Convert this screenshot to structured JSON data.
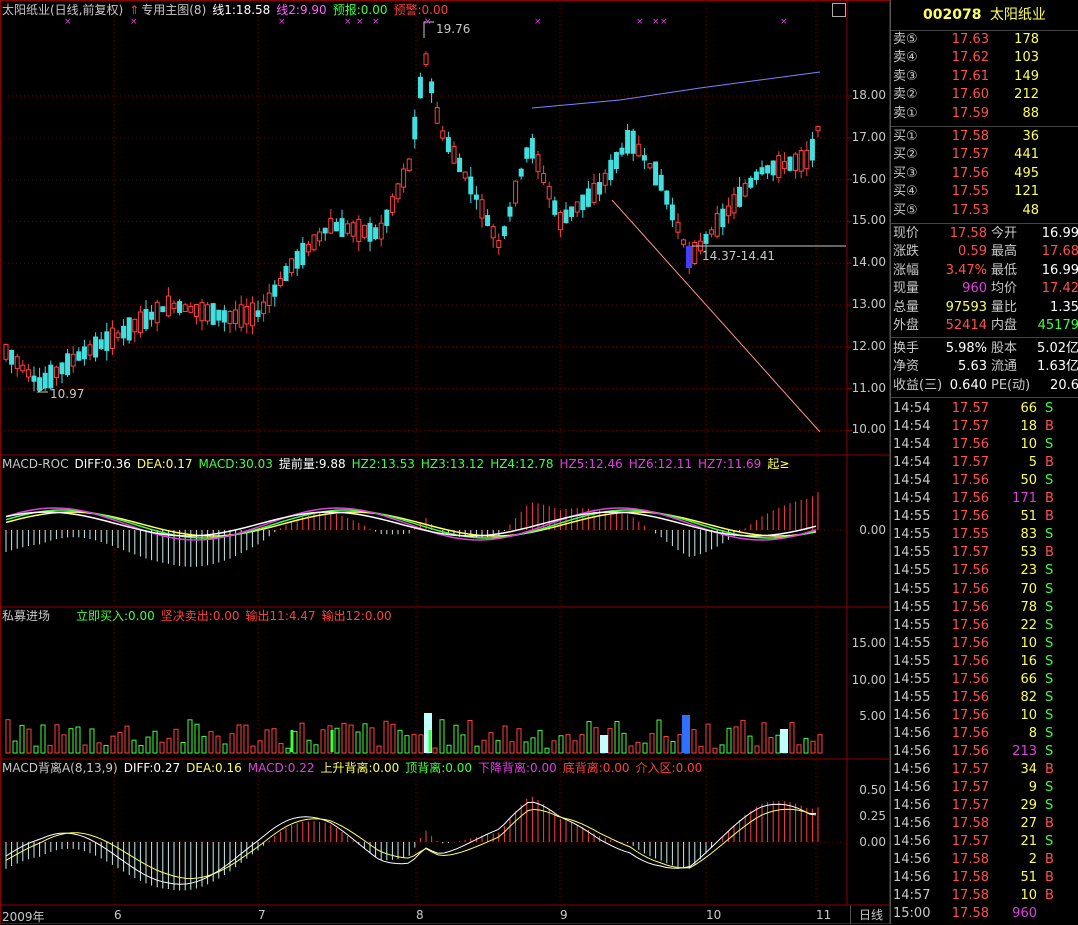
{
  "stock": {
    "code": "002078",
    "name": "太阳纸业"
  },
  "main_title": {
    "name": "太阳纸业(日线,前复权)",
    "indicator": "专用主图(8)",
    "line1": "线1:18.58",
    "line2": "线2:9.90",
    "forecast": "预报:0.00",
    "warning": "预警:0.00"
  },
  "main_labels": {
    "high": "19.76",
    "low": "10.97",
    "range": "14.37-14.41"
  },
  "price_axis": [
    "18.00",
    "17.00",
    "16.00",
    "15.00",
    "14.00",
    "13.00",
    "12.00",
    "11.00",
    "10.00"
  ],
  "macd_roc": {
    "name": "MACD-ROC",
    "diff": "DIFF:0.36",
    "dea": "DEA:0.17",
    "macd": "MACD:30.03",
    "tqz": "提前量:9.88",
    "hz2": "HZ2:13.53",
    "hz3": "HZ3:13.12",
    "hz4": "HZ4:12.78",
    "hz5": "HZ5:12.46",
    "hz6": "HZ6:12.11",
    "hz7": "HZ7:11.69",
    "extra": "起≥",
    "axis": "0.00"
  },
  "private": {
    "name": "私募进场",
    "buy": "立即买入:0.00",
    "sell": "坚决卖出:0.00",
    "out1": "输出11:4.47",
    "out2": "输出12:0.00",
    "axis": [
      "15.00",
      "10.00",
      "5.00"
    ]
  },
  "divergence": {
    "name": "MACD背离A(8,13,9)",
    "diff": "DIFF:0.27",
    "dea": "DEA:0.16",
    "macd": "MACD:0.22",
    "up": "上升背离:0.00",
    "top": "顶背离:0.00",
    "down": "下降背离:0.00",
    "bottom": "底背离:0.00",
    "zone": "介入区:0.00",
    "axis": [
      "0.50",
      "0.25",
      "0.00"
    ]
  },
  "dates": [
    "2009年",
    "6",
    "7",
    "8",
    "9",
    "10",
    "11"
  ],
  "bottom_tab": "日线",
  "sell_orders": [
    {
      "label": "卖⑤",
      "price": "17.63",
      "vol": "178"
    },
    {
      "label": "卖④",
      "price": "17.62",
      "vol": "103"
    },
    {
      "label": "卖③",
      "price": "17.61",
      "vol": "149"
    },
    {
      "label": "卖②",
      "price": "17.60",
      "vol": "212"
    },
    {
      "label": "卖①",
      "price": "17.59",
      "vol": "88"
    }
  ],
  "buy_orders": [
    {
      "label": "买①",
      "price": "17.58",
      "vol": "36"
    },
    {
      "label": "买②",
      "price": "17.57",
      "vol": "441"
    },
    {
      "label": "买③",
      "price": "17.56",
      "vol": "495"
    },
    {
      "label": "买④",
      "price": "17.55",
      "vol": "121"
    },
    {
      "label": "买⑤",
      "price": "17.53",
      "vol": "48"
    }
  ],
  "quote": [
    {
      "l1": "现价",
      "v1": "17.58",
      "c1": "#ff5050",
      "l2": "今开",
      "v2": "16.99",
      "c2": "#ffffff"
    },
    {
      "l1": "涨跌",
      "v1": "0.59",
      "c1": "#ff5050",
      "l2": "最高",
      "v2": "17.68",
      "c2": "#ff5050"
    },
    {
      "l1": "涨幅",
      "v1": "3.47%",
      "c1": "#ff5050",
      "l2": "最低",
      "v2": "16.99",
      "c2": "#ffffff"
    },
    {
      "l1": "现量",
      "v1": "960",
      "c1": "#e040e0",
      "l2": "均价",
      "v2": "17.42",
      "c2": "#ff5050"
    },
    {
      "l1": "总量",
      "v1": "97593",
      "c1": "#ffff60",
      "l2": "量比",
      "v2": "1.35",
      "c2": "#ffffff"
    },
    {
      "l1": "外盘",
      "v1": "52414",
      "c1": "#ff5050",
      "l2": "内盘",
      "v2": "45179",
      "c2": "#40ff40"
    }
  ],
  "quote2": [
    {
      "l1": "换手",
      "v1": "5.98%",
      "l2": "股本",
      "v2": "5.02亿"
    },
    {
      "l1": "净资",
      "v1": "5.63",
      "l2": "流通",
      "v2": "1.63亿"
    },
    {
      "l1": "收益(三)",
      "v1": "0.640",
      "l2": "PE(动)",
      "v2": "20.6"
    }
  ],
  "ticks": [
    {
      "t": "14:54",
      "p": "17.57",
      "v": "66",
      "s": "S"
    },
    {
      "t": "14:54",
      "p": "17.57",
      "v": "18",
      "s": "B"
    },
    {
      "t": "14:54",
      "p": "17.56",
      "v": "10",
      "s": "S"
    },
    {
      "t": "14:54",
      "p": "17.57",
      "v": "5",
      "s": "B"
    },
    {
      "t": "14:54",
      "p": "17.56",
      "v": "50",
      "s": "S"
    },
    {
      "t": "14:54",
      "p": "17.56",
      "v": "171",
      "s": "B"
    },
    {
      "t": "14:55",
      "p": "17.56",
      "v": "51",
      "s": "B"
    },
    {
      "t": "14:55",
      "p": "17.55",
      "v": "83",
      "s": "S"
    },
    {
      "t": "14:55",
      "p": "17.57",
      "v": "53",
      "s": "B"
    },
    {
      "t": "14:55",
      "p": "17.56",
      "v": "23",
      "s": "S"
    },
    {
      "t": "14:55",
      "p": "17.56",
      "v": "70",
      "s": "S"
    },
    {
      "t": "14:55",
      "p": "17.56",
      "v": "78",
      "s": "S"
    },
    {
      "t": "14:55",
      "p": "17.56",
      "v": "22",
      "s": "S"
    },
    {
      "t": "14:55",
      "p": "17.56",
      "v": "10",
      "s": "S"
    },
    {
      "t": "14:55",
      "p": "17.56",
      "v": "16",
      "s": "S"
    },
    {
      "t": "14:55",
      "p": "17.56",
      "v": "66",
      "s": "S"
    },
    {
      "t": "14:55",
      "p": "17.56",
      "v": "82",
      "s": "S"
    },
    {
      "t": "14:56",
      "p": "17.56",
      "v": "10",
      "s": "S"
    },
    {
      "t": "14:56",
      "p": "17.56",
      "v": "8",
      "s": "S"
    },
    {
      "t": "14:56",
      "p": "17.56",
      "v": "213",
      "s": "S"
    },
    {
      "t": "14:56",
      "p": "17.57",
      "v": "34",
      "s": "B"
    },
    {
      "t": "14:56",
      "p": "17.57",
      "v": "9",
      "s": "S"
    },
    {
      "t": "14:56",
      "p": "17.57",
      "v": "29",
      "s": "S"
    },
    {
      "t": "14:56",
      "p": "17.58",
      "v": "27",
      "s": "B"
    },
    {
      "t": "14:56",
      "p": "17.57",
      "v": "21",
      "s": "S"
    },
    {
      "t": "14:56",
      "p": "17.58",
      "v": "2",
      "s": "B"
    },
    {
      "t": "14:56",
      "p": "17.58",
      "v": "51",
      "s": "B"
    },
    {
      "t": "14:57",
      "p": "17.58",
      "v": "10",
      "s": "B"
    },
    {
      "t": "15:00",
      "p": "17.58",
      "v": "960",
      "s": ""
    }
  ],
  "colors": {
    "up": "#ff4040",
    "down": "#40e0e0",
    "grid": "#8b0000",
    "accent": "#ffd700"
  }
}
